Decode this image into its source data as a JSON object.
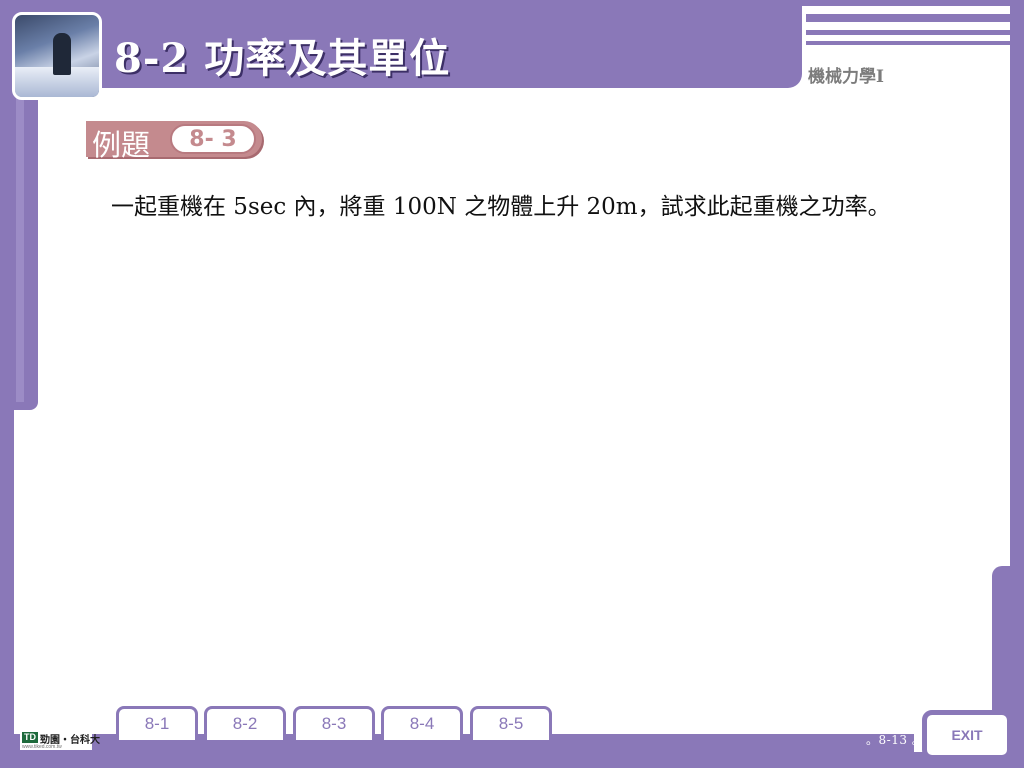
{
  "header": {
    "title": "8-2  功率及其單位",
    "book_title": "機械力學I",
    "thumbnail_icon": "rafting-photo-icon"
  },
  "example": {
    "label": "例題",
    "number": "8- 3"
  },
  "problem": {
    "text": "一起重機在 5sec 內，將重 100N 之物體上升 20m，試求此起重機之功率。"
  },
  "nav": {
    "tabs": [
      "8-1",
      "8-2",
      "8-3",
      "8-4",
      "8-5"
    ],
    "exit_label": "EXIT"
  },
  "footer": {
    "page_number": "。8-13 。",
    "logo_mark": "TD",
    "logo_text": "勁園‧台科大",
    "logo_url": "www.tiked.com.tw"
  },
  "colors": {
    "frame": "#8a78b8",
    "badge": "#c48a8e",
    "book_title": "#7c7c7c"
  }
}
